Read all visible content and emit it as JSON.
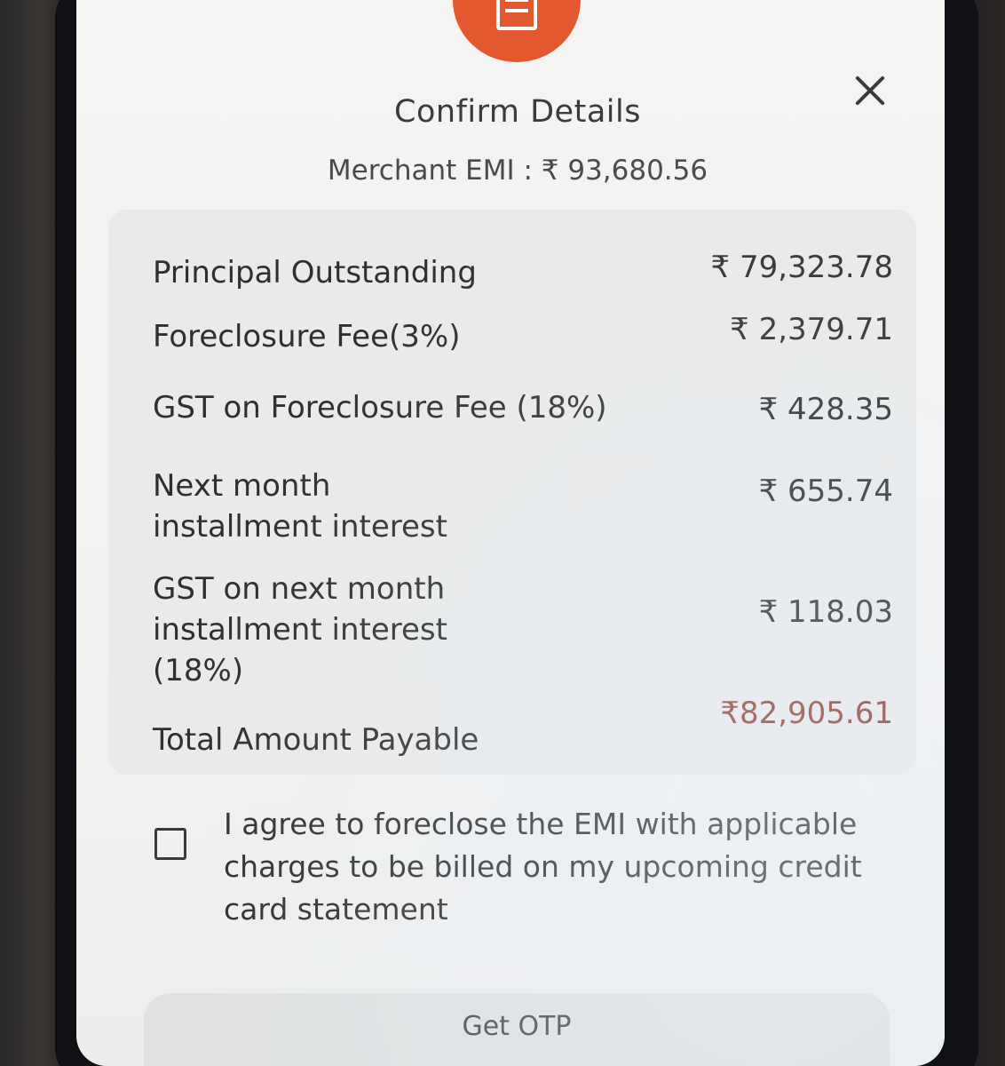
{
  "dialog": {
    "title": "Confirm Details",
    "subtitle": "Merchant EMI : ₹ 93,680.56",
    "header_icon": "document-list-icon",
    "close_icon": "close-icon"
  },
  "details": {
    "rows": [
      {
        "label": "Principal Outstanding",
        "value": "₹ 79,323.78"
      },
      {
        "label": "Foreclosure Fee(3%)",
        "value": "₹ 2,379.71"
      },
      {
        "label": "GST on Foreclosure Fee (18%)",
        "value": "₹ 428.35"
      },
      {
        "label": "Next month installment interest",
        "value": "₹ 655.74"
      },
      {
        "label": "GST on next month installment interest (18%)",
        "value": "₹ 118.03"
      },
      {
        "label": "Total Amount Payable",
        "value": "₹82,905.61"
      }
    ]
  },
  "consent": {
    "checked": false,
    "text": "I agree to foreclose the EMI with applicable charges to be billed on my upcoming credit card statement"
  },
  "actions": {
    "get_otp_label": "Get OTP"
  },
  "colors": {
    "accent": "#e4582f",
    "total_value": "#8e3b30",
    "card_background": "#e9eaea",
    "screen_background": "#f4f4f3"
  }
}
